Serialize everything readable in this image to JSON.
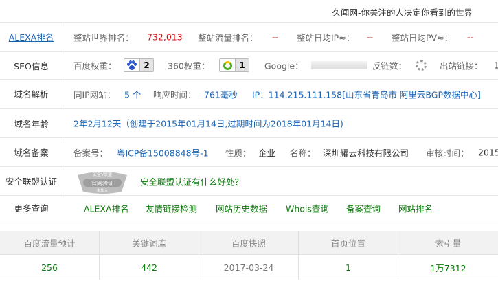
{
  "header": {
    "tagline": "久闻网-你关注的人决定你看到的世界"
  },
  "alexa": {
    "label": "ALEXA排名",
    "world_rank_label": "整站世界排名：",
    "world_rank_value": "732,013",
    "traffic_rank_label": "整站流量排名：",
    "traffic_rank_value": "--",
    "daily_ip_label": "整站日均IP≈：",
    "daily_ip_value": "--",
    "daily_pv_label": "整站日均PV≈：",
    "daily_pv_value": "--"
  },
  "seo": {
    "label": "SEO信息",
    "baidu_label": "百度权重：",
    "baidu_value": "2",
    "s360_label": "360权重：",
    "s360_value": "1",
    "google_label": "Google：",
    "backlinks_label": "反链数：",
    "outlinks_label": "出站链接：",
    "outlinks_value": "1"
  },
  "dns": {
    "label": "域名解析",
    "same_ip_label": "同IP网站：",
    "same_ip_value": "5 个",
    "response_label": "响应时间：",
    "response_value": "761毫秒",
    "ip_text": "IP：114.215.111.158[山东省青岛市 阿里云BGP数据中心]"
  },
  "age": {
    "label": "域名年龄",
    "text": "2年2月12天（创建于2015年01月14日,过期时间为2018年01月14日)"
  },
  "icp": {
    "label": "域名备案",
    "number_label": "备案号：",
    "number_value": "粤ICP备15008848号-1",
    "nature_label": "性质：",
    "nature_value": "企业",
    "name_label": "名称：",
    "name_value": "深圳耀云科技有限公司",
    "audit_label": "审核时间：",
    "audit_value": "2015"
  },
  "security": {
    "label": "安全联盟认证",
    "link": "安全联盟认证有什么好处？",
    "seal_top": "安全V联盟",
    "seal_main": "官网验证",
    "seal_bottom": "未加入"
  },
  "more": {
    "label": "更多查询",
    "links": [
      "ALEXA排名",
      "友情链接检测",
      "网站历史数据",
      "Whois查询",
      "备案查询",
      "网站排名"
    ]
  },
  "stats_table": {
    "headers": [
      "百度流量预计",
      "关键词库",
      "百度快照",
      "首页位置",
      "索引量"
    ],
    "values": [
      "256",
      "442",
      "2017-03-24",
      "1",
      "1万7312"
    ]
  },
  "colors": {
    "link": "#1a64b4",
    "value_red": "#dd0000",
    "value_green": "#0a7a0a",
    "baidu_icon": "#2b55c9",
    "s360_icon": "#4caf20"
  },
  "icons": {
    "baidu": "baidu-paw-icon",
    "s360": "360-ring-icon",
    "backlinks": "loading-spinner-icon"
  }
}
